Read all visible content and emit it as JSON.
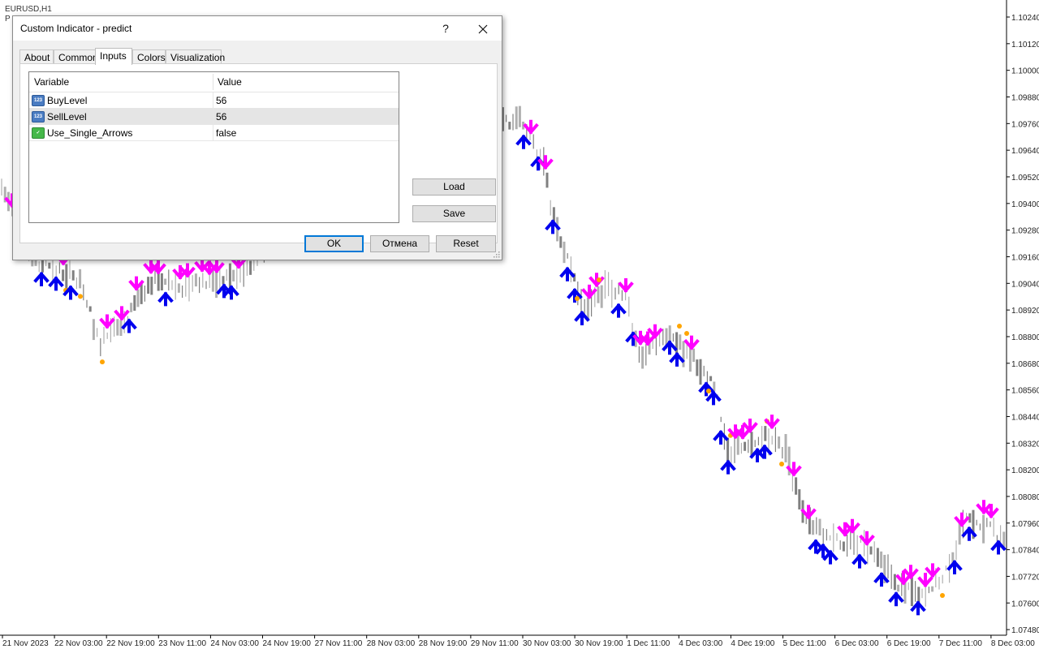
{
  "chart": {
    "symbol": "EURUSD,H1",
    "symbol_sub": "P",
    "price_labels": [
      "1.10240",
      "1.10120",
      "1.10000",
      "1.09880",
      "1.09760",
      "1.09640",
      "1.09520",
      "1.09400",
      "1.09280",
      "1.09160",
      "1.09040",
      "1.08920",
      "1.08800",
      "1.08680",
      "1.08560",
      "1.08440",
      "1.08320",
      "1.08200",
      "1.08080",
      "1.07960",
      "1.07840",
      "1.07720",
      "1.07600",
      "1.07480"
    ],
    "time_labels": [
      "21 Nov 2023",
      "22 Nov 03:00",
      "22 Nov 19:00",
      "23 Nov 11:00",
      "24 Nov 03:00",
      "24 Nov 19:00",
      "27 Nov 11:00",
      "28 Nov 03:00",
      "28 Nov 19:00",
      "29 Nov 11:00",
      "30 Nov 03:00",
      "30 Nov 19:00",
      "1 Dec 11:00",
      "4 Dec 03:00",
      "4 Dec 19:00",
      "5 Dec 11:00",
      "6 Dec 03:00",
      "6 Dec 19:00",
      "7 Dec 11:00",
      "8 Dec 03:00"
    ],
    "colors": {
      "bull_arrow": "#0000ee",
      "bear_arrow": "#ff00ff",
      "dot": "#ffa500",
      "bar": "#808080"
    }
  },
  "dialog": {
    "title": "Custom Indicator - predict",
    "help_label": "?",
    "close_label": "✕",
    "tabs": [
      "About",
      "Common",
      "Inputs",
      "Colors",
      "Visualization"
    ],
    "active_tab": "Inputs",
    "grid": {
      "headers": {
        "variable": "Variable",
        "value": "Value"
      },
      "rows": [
        {
          "icon": "number-param-icon",
          "icon_text": "123",
          "name": "BuyLevel",
          "value": "56"
        },
        {
          "icon": "number-param-icon",
          "icon_text": "123",
          "name": "SellLevel",
          "value": "56"
        },
        {
          "icon": "bool-param-icon",
          "icon_text": "✓",
          "name": "Use_Single_Arrows",
          "value": "false"
        }
      ]
    },
    "buttons": {
      "load": "Load",
      "save": "Save",
      "ok": "OK",
      "cancel": "Отмена",
      "reset": "Reset"
    }
  }
}
